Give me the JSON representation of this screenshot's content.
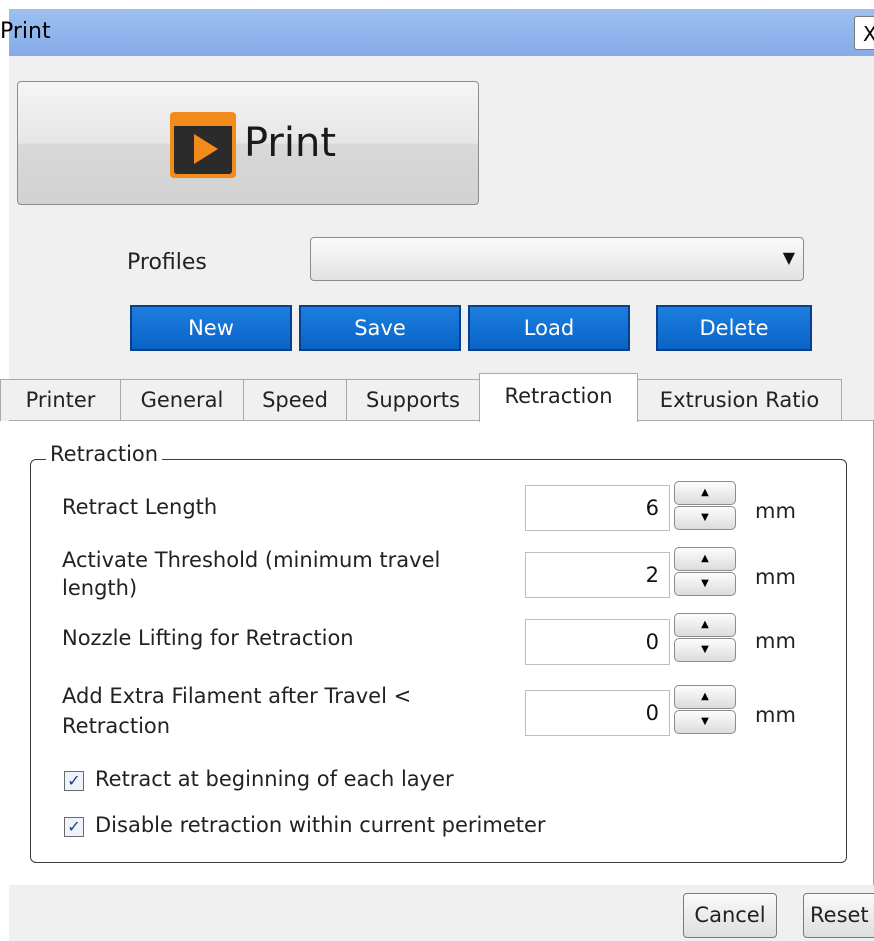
{
  "window": {
    "title": "Print",
    "close_glyph": "X"
  },
  "print_button": {
    "label": "Print",
    "icon": "play-icon",
    "icon_color": "#f28a1c"
  },
  "profiles": {
    "label": "Profiles",
    "selected": "",
    "arrow_glyph": "▼"
  },
  "profile_buttons": {
    "new": "New",
    "save": "Save",
    "load": "Load",
    "delete": "Delete",
    "color": "#0a63c6"
  },
  "tabs": [
    {
      "label": "Printer"
    },
    {
      "label": "General"
    },
    {
      "label": "Speed"
    },
    {
      "label": "Supports"
    },
    {
      "label": "Retraction",
      "active": true
    },
    {
      "label": "Extrusion Ratio"
    }
  ],
  "retraction": {
    "group_title": "Retraction",
    "fields": [
      {
        "label": "Retract Length",
        "value": "6",
        "unit": "mm"
      },
      {
        "label_line1": "Activate Threshold (minimum travel",
        "label_line2": "length)",
        "value": "2",
        "unit": "mm"
      },
      {
        "label": "Nozzle Lifting for Retraction",
        "value": "0",
        "unit": "mm"
      },
      {
        "label_line1": "Add Extra Filament after Travel <",
        "label_line2": "Retraction",
        "value": "0",
        "unit": "mm"
      }
    ],
    "checkboxes": [
      {
        "label": "Retract at beginning of each layer",
        "checked": true
      },
      {
        "label": "Disable retraction within current perimeter",
        "checked": true
      }
    ],
    "check_glyph": "✓",
    "spin_up_glyph": "▲",
    "spin_down_glyph": "▼"
  },
  "footer": {
    "cancel": "Cancel",
    "reset": "Reset"
  }
}
